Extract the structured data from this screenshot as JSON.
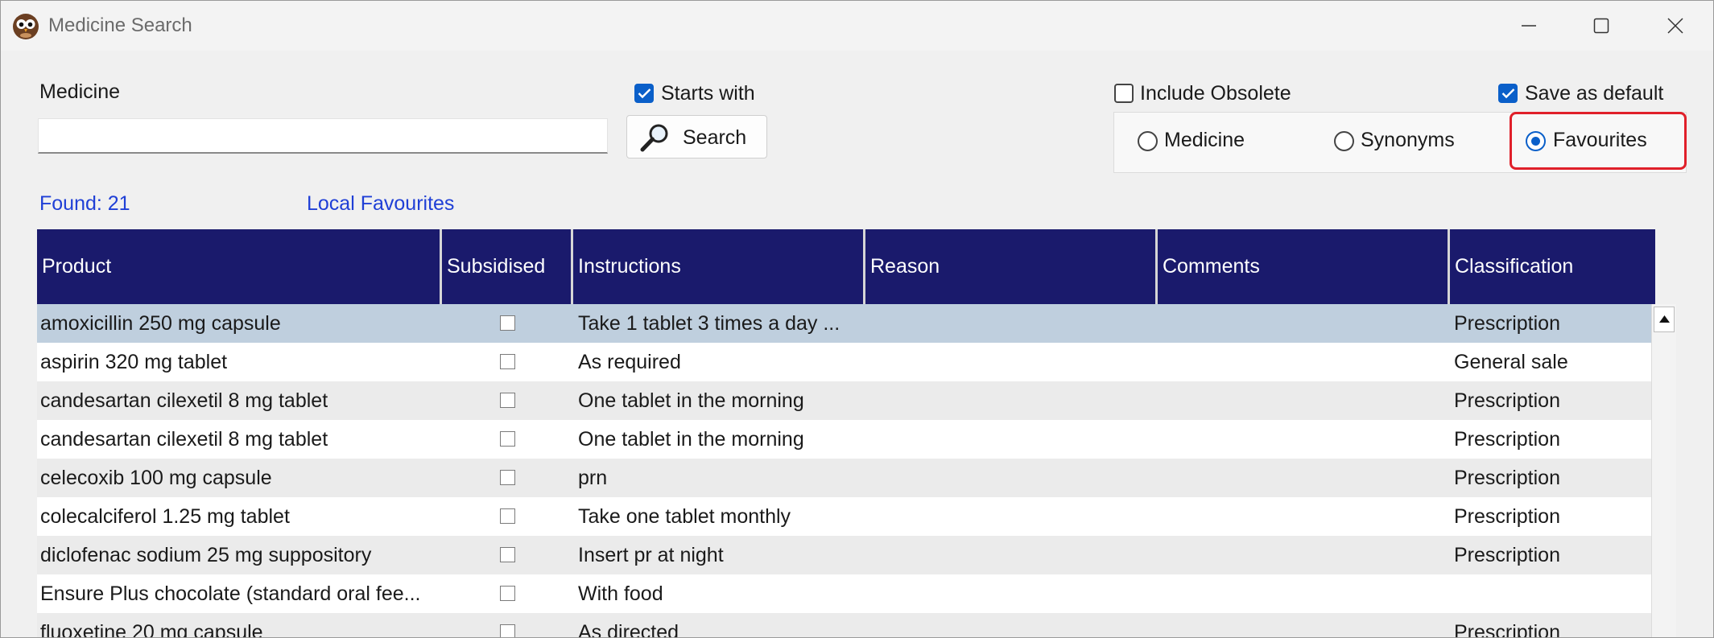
{
  "window": {
    "title": "Medicine Search"
  },
  "search": {
    "medicine_label": "Medicine",
    "medicine_value": "",
    "starts_with_label": "Starts with",
    "starts_with_checked": true,
    "search_button_label": "Search",
    "include_obsolete_label": "Include Obsolete",
    "include_obsolete_checked": false,
    "save_default_label": "Save as default",
    "save_default_checked": true,
    "search_mode": {
      "options": [
        "Medicine",
        "Synonyms",
        "Favourites"
      ],
      "selected": "Favourites"
    }
  },
  "status": {
    "found_text": "Found: 21",
    "list_label": "Local Favourites"
  },
  "table": {
    "columns": [
      "Product",
      "Subsidised",
      "Instructions",
      "Reason",
      "Comments",
      "Classification"
    ],
    "rows": [
      {
        "product": "amoxicillin 250 mg capsule",
        "subsidised": false,
        "instructions": "Take 1 tablet 3 times a day ...",
        "reason": "",
        "comments": "",
        "classification": "Prescription",
        "selected": true
      },
      {
        "product": "aspirin 320 mg tablet",
        "subsidised": false,
        "instructions": "As required",
        "reason": "",
        "comments": "",
        "classification": "General sale"
      },
      {
        "product": "candesartan cilexetil 8 mg tablet",
        "subsidised": false,
        "instructions": "One tablet in the morning",
        "reason": "",
        "comments": "",
        "classification": "Prescription"
      },
      {
        "product": "candesartan cilexetil 8 mg tablet",
        "subsidised": false,
        "instructions": "One tablet in the morning",
        "reason": "",
        "comments": "",
        "classification": "Prescription"
      },
      {
        "product": "celecoxib 100 mg capsule",
        "subsidised": false,
        "instructions": "prn",
        "reason": "",
        "comments": "",
        "classification": "Prescription"
      },
      {
        "product": "colecalciferol 1.25 mg tablet",
        "subsidised": false,
        "instructions": "Take one tablet monthly",
        "reason": "",
        "comments": "",
        "classification": "Prescription"
      },
      {
        "product": "diclofenac sodium 25 mg suppository",
        "subsidised": false,
        "instructions": "Insert pr at night",
        "reason": "",
        "comments": "",
        "classification": "Prescription"
      },
      {
        "product": "Ensure Plus chocolate (standard oral fee...",
        "subsidised": false,
        "instructions": "With food",
        "reason": "",
        "comments": "",
        "classification": ""
      },
      {
        "product": "fluoxetine 20 mg capsule",
        "subsidised": false,
        "instructions": "As directed",
        "reason": "",
        "comments": "",
        "classification": "Prescription"
      }
    ]
  },
  "colors": {
    "header_bg": "#1a1a6c",
    "selected_row": "#bfcfde",
    "accent": "#0a5fc9",
    "link_text": "#1f3fd6",
    "highlight": "#e0202a"
  },
  "icons": {
    "app": "owl-icon",
    "search_button": "magnifier-icon",
    "minimize": "minimize-icon",
    "maximize": "maximize-icon",
    "close": "close-icon"
  }
}
